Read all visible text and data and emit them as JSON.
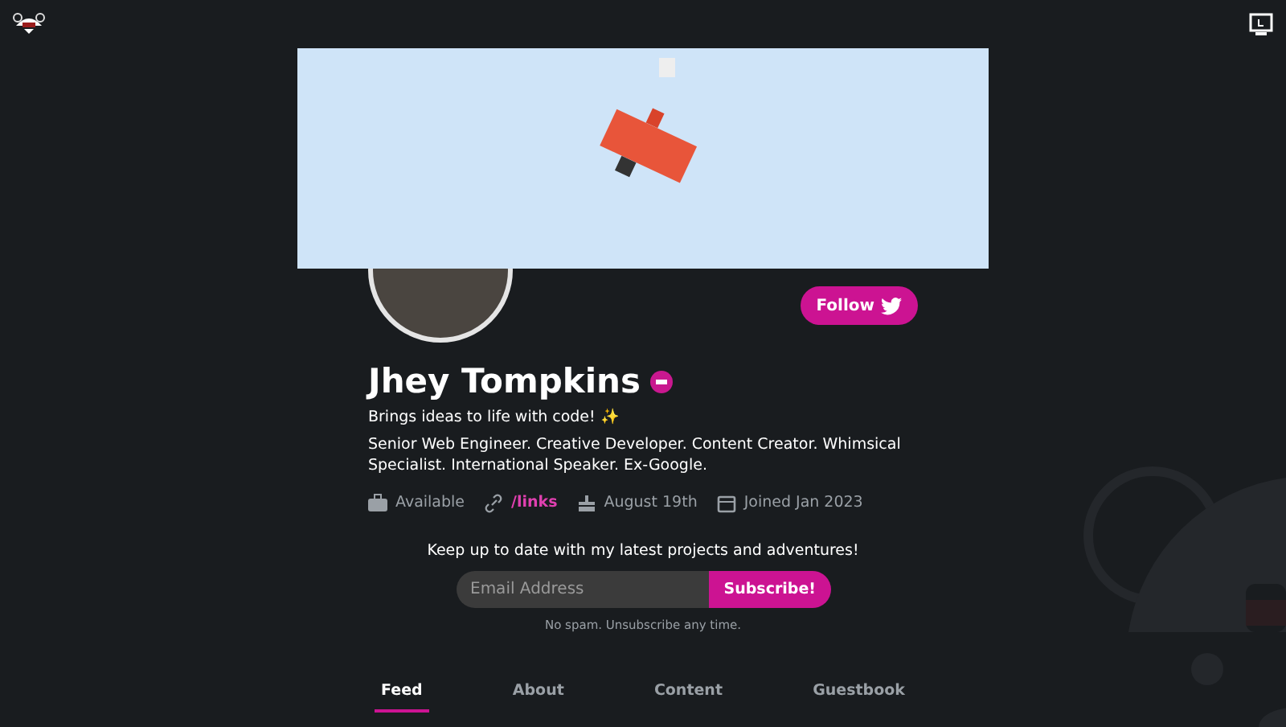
{
  "profile": {
    "name": "Jhey Tompkins",
    "tagline": "Brings ideas to life with code! ✨",
    "bio": "Senior Web Engineer. Creative Developer. Content Creator. Whimsical Specialist. International Speaker. Ex-Google.",
    "follow_button": "Follow"
  },
  "meta": [
    {
      "kind": "status",
      "text": "Available"
    },
    {
      "kind": "link",
      "text": "/links"
    },
    {
      "kind": "birthday",
      "text": "August 19th"
    },
    {
      "kind": "joined",
      "text": "Joined Jan 2023"
    }
  ],
  "newsletter": {
    "heading": "Keep up to date with my latest projects and adventures!",
    "placeholder": "Email Address",
    "button": "Subscribe!",
    "note": "No spam. Unsubscribe any time."
  },
  "tabs": [
    {
      "label": "Feed",
      "selected": true
    },
    {
      "label": "About",
      "selected": false
    },
    {
      "label": "Content",
      "selected": false
    },
    {
      "label": "Guestbook",
      "selected": false
    }
  ]
}
